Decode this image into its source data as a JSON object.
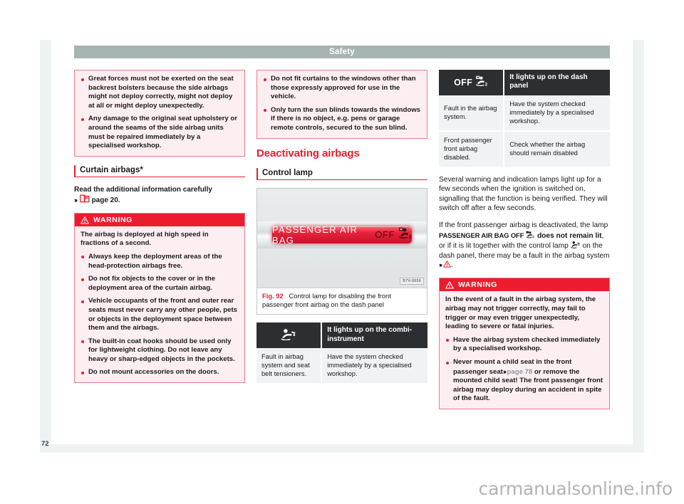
{
  "header": {
    "title": "Safety"
  },
  "page_number": "72",
  "watermark": "carmanualsonline.info",
  "column1": {
    "note_box": {
      "bullets": [
        "Great forces must not be exerted on the seat backrest bolsters because the side airbags might not deploy correctly, might not deploy at all or might deploy unexpectedly.",
        "Any damage to the original seat upholstery or around the seams of the side airbag units must be repaired immediately by a specialised workshop."
      ]
    },
    "section_heading": "Curtain airbags*",
    "read_info_prefix": "Read the additional information carefully",
    "read_info_chevron": "›››",
    "read_info_page": "page 20.",
    "warning": {
      "label": "WARNING",
      "intro": "The airbag is deployed at high speed in fractions of a second.",
      "bullets": [
        "Always keep the deployment areas of the head-protection airbags free.",
        "Do not fix objects to the cover or in the deployment area of the curtain airbag.",
        "Vehicle occupants of the front and outer rear seats must never carry any other people, pets or objects in the deployment space between them and the airbags.",
        "The built-in coat hooks should be used only for lightweight clothing. Do not leave any heavy or sharp-edged objects in the pockets.",
        "Do not mount accessories on the doors."
      ]
    }
  },
  "column2": {
    "note_box": {
      "bullets": [
        "Do not fit curtains to the windows other than those expressly approved for use in the vehicle.",
        "Only turn the sun blinds towards the windows if there is no object, e.g. pens or garage remote controls, secured to the sun blind."
      ]
    },
    "main_heading": "Deactivating airbags",
    "sub_heading": "Control lamp",
    "figure": {
      "lamp_text": "PASSENGER  AIR  BAG",
      "lamp_off": "OFF",
      "lamp_icon": "passenger-airbag-off-icon",
      "image_code": "B7V-0656",
      "fig_label": "Fig. 92",
      "caption": "Control lamp for disabling the front passenger front airbag on the dash panel"
    },
    "table": {
      "header_icon": "airbag-warning-icon",
      "header_text": "It lights up on the combi-instrument",
      "rows": [
        {
          "cause": "Fault in airbag system and seat belt tensioners.",
          "action": "Have the system checked immediately by a specialised workshop."
        }
      ]
    }
  },
  "column3": {
    "table": {
      "header_off": "OFF",
      "header_icon": "passenger-airbag-off-icon",
      "header_text": "It lights up on the dash panel",
      "rows": [
        {
          "cause": "Fault in the airbag system.",
          "action": "Have the system checked immediately by a specialised workshop."
        },
        {
          "cause": "Front passenger front airbag disabled.",
          "action": "Check whether the airbag should remain disabled"
        }
      ]
    },
    "para1": "Several warning and indication lamps light up for a few seconds when the ignition is switched on, signalling that the function is being verified. They will switch off after a few seconds.",
    "para2_part1": "If the front passenger airbag is deactivated, the lamp ",
    "para2_lamp": "PASSENGER AIR BAG OFF",
    "para2_part2": " does not remain lit",
    "para2_part3": ", or if it is lit together with the control lamp ",
    "para2_part4": " on the dash panel, there may be a fault in the airbag system ",
    "para2_chevron": "›››",
    "warning": {
      "label": "WARNING",
      "intro": "In the event of a fault in the airbag system, the airbag may not trigger correctly, may fail to trigger or may even trigger unexpectedly, leading to severe or fatal injuries.",
      "bullets": [
        "Have the airbag system checked immediately by a specialised workshop.",
        "Never mount a child seat in the front passenger seat"
      ],
      "bullet2_chevron": "›››",
      "bullet2_pagelink": "page 78",
      "bullet2_rest": " or remove the mounted child seat! The front passenger front airbag may deploy during an accident in spite of the fault."
    }
  },
  "colors": {
    "accent_red": "#ec1c2e",
    "header_grey": "#a7b4b4",
    "pink_bg": "#fdeef1",
    "pink_border": "#ef7a8e",
    "table_header": "#2b2f31",
    "table_cell": "#f0f2f3"
  }
}
